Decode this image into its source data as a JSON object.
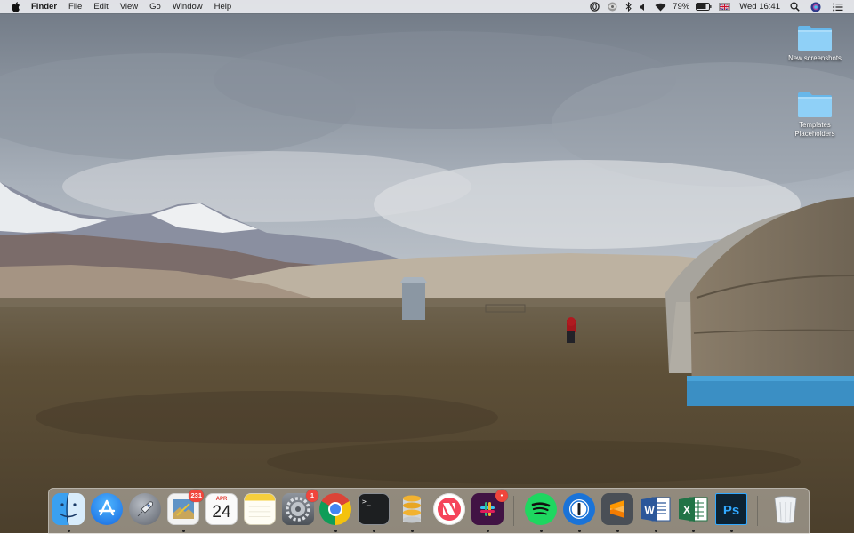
{
  "menubar": {
    "app_name": "Finder",
    "menus": [
      "File",
      "Edit",
      "View",
      "Go",
      "Window",
      "Help"
    ],
    "battery_percent": "79%",
    "clock": "Wed 16:41",
    "status_icons": [
      "opera-icon",
      "eye-icon",
      "bluetooth-icon",
      "volume-icon",
      "wifi-icon",
      "battery-icon",
      "uk-flag-icon",
      "spotlight-search-icon",
      "siri-icon",
      "notification-center-icon"
    ]
  },
  "desktop": {
    "icons": [
      {
        "label": "New screenshots",
        "type": "folder"
      },
      {
        "label": "Templates Placeholders",
        "type": "folder"
      }
    ]
  },
  "dock": {
    "apps": [
      {
        "name": "Finder",
        "icon": "finder-icon",
        "running": true
      },
      {
        "name": "App Store",
        "icon": "app-store-icon",
        "running": false
      },
      {
        "name": "Launchpad",
        "icon": "launchpad-icon",
        "running": false
      },
      {
        "name": "Preview",
        "icon": "preview-icon",
        "running": true,
        "badge": "231"
      },
      {
        "name": "Calendar",
        "icon": "calendar-icon",
        "running": false,
        "month": "APR",
        "day": "24"
      },
      {
        "name": "Notes",
        "icon": "notes-icon",
        "running": false
      },
      {
        "name": "System Preferences",
        "icon": "system-preferences-icon",
        "running": false,
        "badge": "1"
      },
      {
        "name": "Chrome",
        "icon": "chrome-icon",
        "running": true
      },
      {
        "name": "Terminal",
        "icon": "terminal-icon",
        "running": true,
        "prompt": ">_"
      },
      {
        "name": "Sequel Pro",
        "icon": "database-icon",
        "running": true
      },
      {
        "name": "News",
        "icon": "news-icon",
        "running": false
      },
      {
        "name": "Slack",
        "icon": "slack-icon",
        "running": true,
        "badge": "•"
      },
      {
        "name": "Spotify",
        "icon": "spotify-icon",
        "running": true
      },
      {
        "name": "1Password",
        "icon": "onepassword-icon",
        "running": true
      },
      {
        "name": "Sublime Text",
        "icon": "sublime-text-icon",
        "running": true
      },
      {
        "name": "Word",
        "icon": "word-icon",
        "running": true
      },
      {
        "name": "Excel",
        "icon": "excel-icon",
        "running": true
      },
      {
        "name": "Photoshop",
        "icon": "photoshop-icon",
        "running": true
      },
      {
        "name": "Trash",
        "icon": "trash-icon",
        "running": false
      }
    ],
    "colors": {
      "finder": "#3aa0f0",
      "appstore": "#1e88f5",
      "chrome_red": "#db4437",
      "spotify": "#1ed760",
      "word": "#2b579a",
      "excel": "#217346",
      "photoshop": "#31a8ff"
    }
  }
}
